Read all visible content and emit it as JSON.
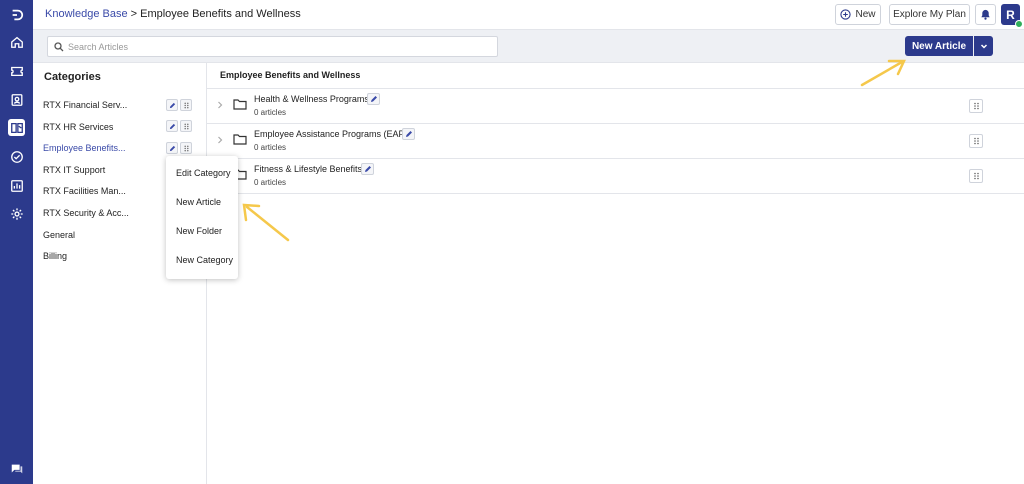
{
  "breadcrumb": {
    "root": "Knowledge Base",
    "separator": ">",
    "current": "Employee Benefits and Wellness"
  },
  "header": {
    "new_label": "New",
    "explore_label": "Explore My Plan",
    "avatar_initial": "R"
  },
  "search": {
    "placeholder": "Search Articles"
  },
  "toolbar": {
    "new_article_label": "New Article"
  },
  "categories": {
    "title": "Categories",
    "items": [
      {
        "label": "RTX Financial Serv..."
      },
      {
        "label": "RTX HR Services"
      },
      {
        "label": "Employee Benefits..."
      },
      {
        "label": "RTX IT Support"
      },
      {
        "label": "RTX Facilities Man..."
      },
      {
        "label": "RTX Security & Acc..."
      },
      {
        "label": "General"
      },
      {
        "label": "Billing"
      }
    ]
  },
  "context_menu": {
    "items": [
      {
        "label": "Edit Category"
      },
      {
        "label": "New Article"
      },
      {
        "label": "New Folder"
      },
      {
        "label": "New Category"
      }
    ]
  },
  "main": {
    "title": "Employee Benefits and Wellness",
    "folders": [
      {
        "name": "Health & Wellness Programs",
        "count": "0 articles"
      },
      {
        "name": "Employee Assistance Programs (EAP)",
        "count": "0 articles"
      },
      {
        "name": "Fitness & Lifestyle Benefits",
        "count": "0 articles"
      }
    ]
  },
  "colors": {
    "brand": "#2c3a8c",
    "link": "#3a4aa8",
    "annotation": "#f5c84b",
    "status_online": "#2fae5a"
  },
  "icons": [
    "logo-icon",
    "home-icon",
    "ticket-icon",
    "contacts-icon",
    "knowledge-base-icon",
    "tasks-icon",
    "reports-icon",
    "settings-icon",
    "chat-icon",
    "plus-circle-icon",
    "bell-icon",
    "search-icon",
    "chevron-down-icon",
    "edit-icon",
    "drag-handle-icon",
    "chevron-right-icon",
    "folder-icon"
  ]
}
